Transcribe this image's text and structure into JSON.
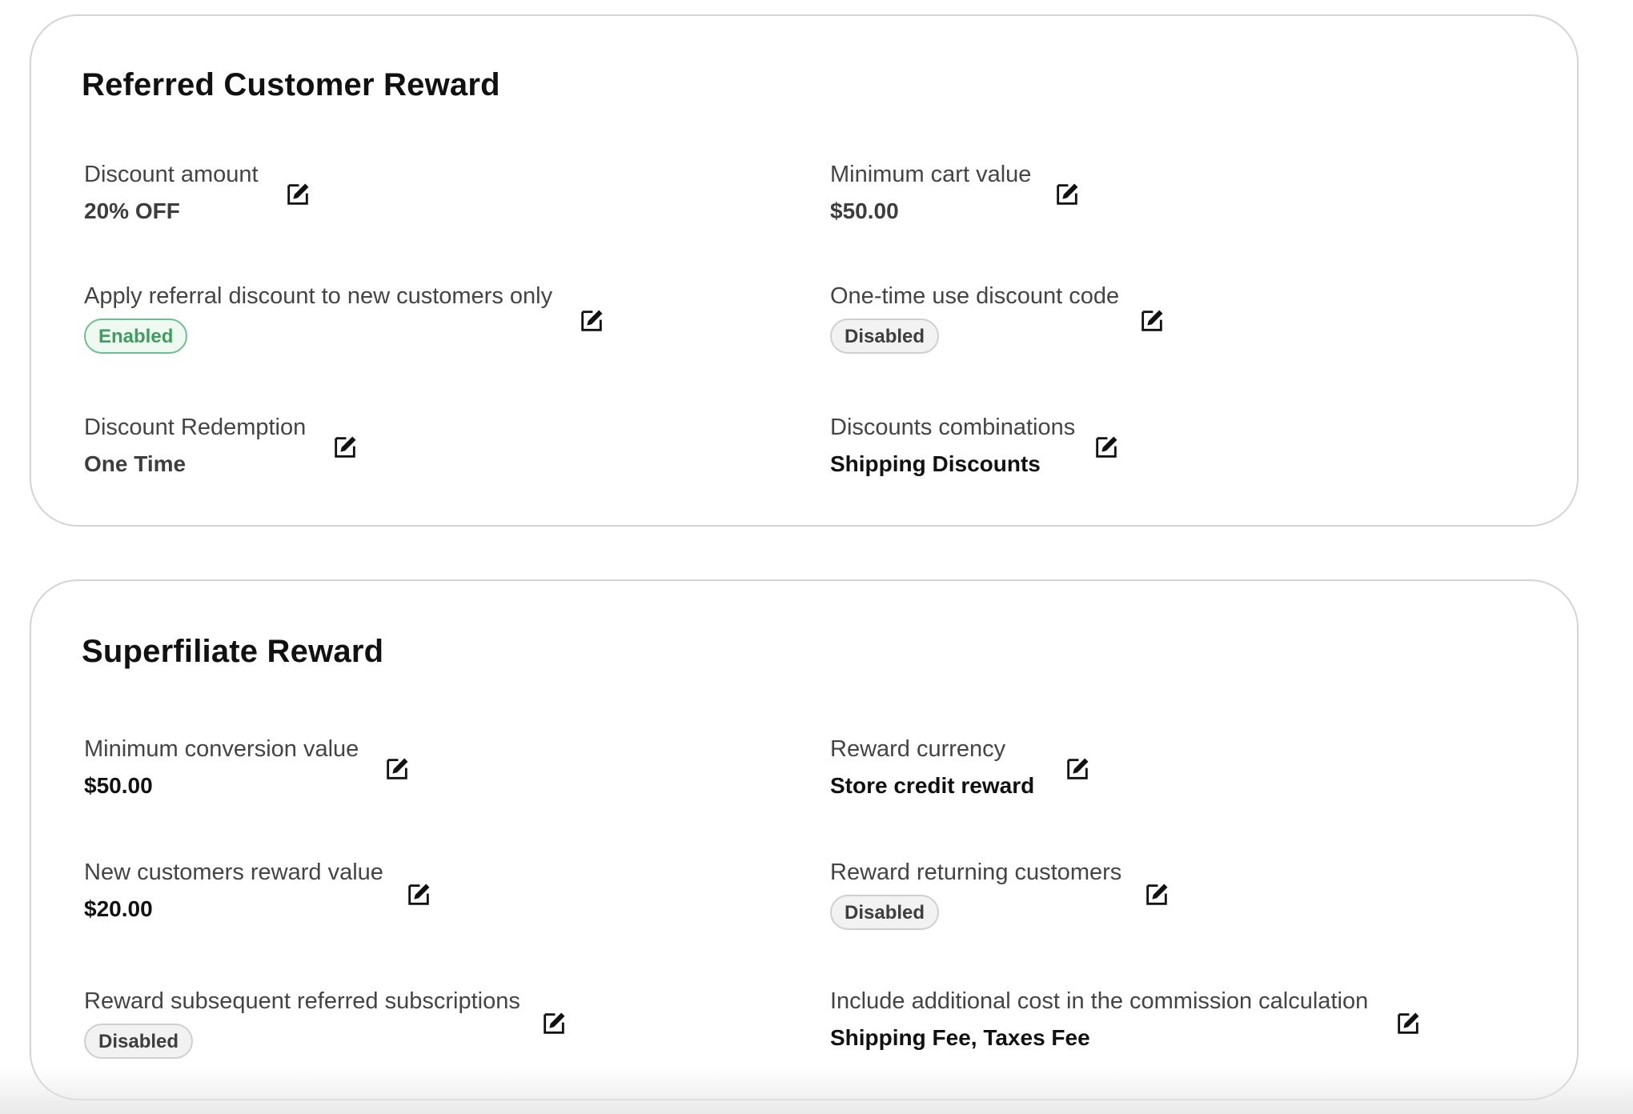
{
  "referred_customer_reward": {
    "title": "Referred Customer Reward",
    "discount_amount": {
      "label": "Discount amount",
      "value": "20% OFF"
    },
    "minimum_cart_value": {
      "label": "Minimum cart value",
      "value": "$50.00"
    },
    "new_customers_only": {
      "label": "Apply referral discount to new customers only",
      "value": "Enabled"
    },
    "one_time_code": {
      "label": "One-time use discount code",
      "value": "Disabled"
    },
    "discount_redemption": {
      "label": "Discount Redemption",
      "value": "One Time"
    },
    "discounts_combinations": {
      "label": "Discounts combinations",
      "value": "Shipping Discounts"
    }
  },
  "superfiliate_reward": {
    "title": "Superfiliate Reward",
    "minimum_conversion_value": {
      "label": "Minimum conversion value",
      "value": "$50.00"
    },
    "reward_currency": {
      "label": "Reward currency",
      "value": "Store credit reward"
    },
    "new_customers_reward_value": {
      "label": "New customers reward value",
      "value": "$20.00"
    },
    "reward_returning_customers": {
      "label": "Reward returning customers",
      "value": "Disabled"
    },
    "reward_subsequent_subscriptions": {
      "label": "Reward subsequent referred subscriptions",
      "value": "Disabled"
    },
    "include_additional_cost": {
      "label": "Include additional cost in the commission calculation",
      "value": "Shipping Fee, Taxes Fee"
    }
  },
  "icons": {
    "edit": "edit-icon"
  },
  "colors": {
    "enabled_text": "#3f9e5f",
    "enabled_border": "#6cc08b",
    "disabled_border": "#cfcfcf",
    "card_border": "#d4d4d4"
  }
}
